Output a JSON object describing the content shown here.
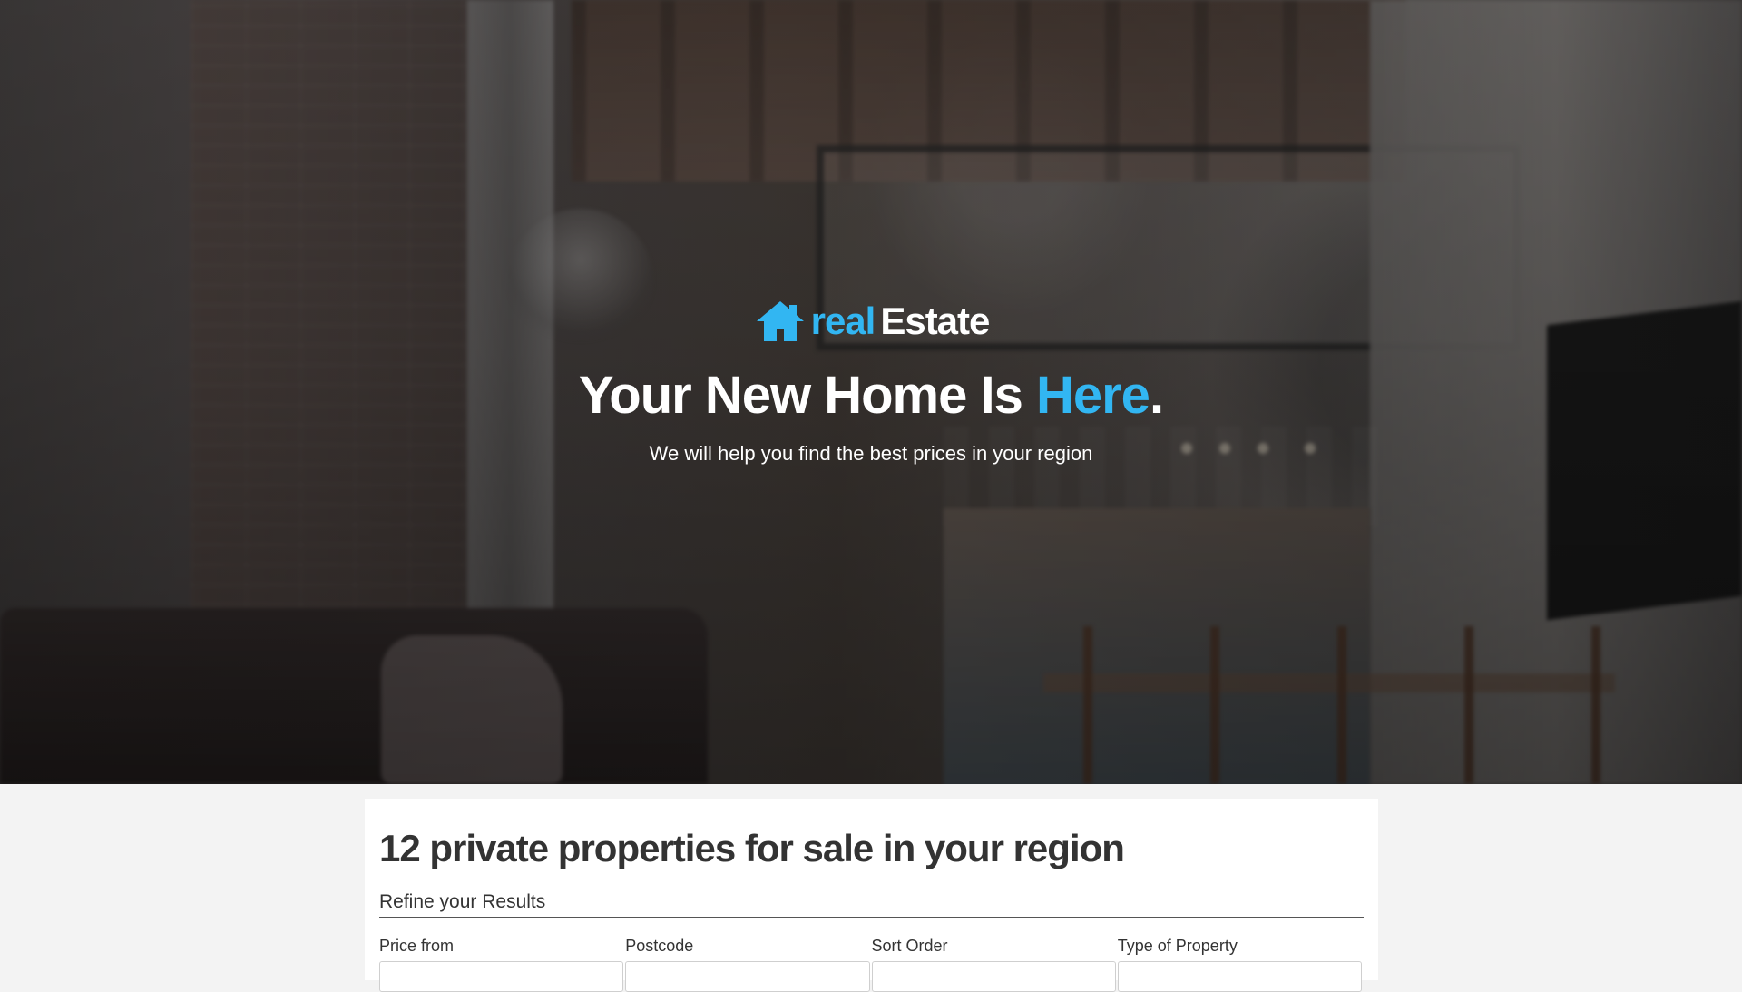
{
  "hero": {
    "brand_real": "real",
    "brand_estate": "Estate",
    "title_prefix": "Your New Home Is ",
    "title_highlight": "Here",
    "title_suffix": ".",
    "subtitle": "We will help you find the best prices in your region",
    "icon": "home-icon"
  },
  "results": {
    "heading": "12 private properties for sale in your region",
    "refine_title": "Refine your Results",
    "filters": [
      {
        "label": "Price from",
        "value": ""
      },
      {
        "label": "Postcode",
        "value": ""
      },
      {
        "label": "Sort Order",
        "value": ""
      },
      {
        "label": "Type of Property",
        "value": ""
      }
    ]
  },
  "colors": {
    "accent": "#32b6f2",
    "text_dark": "#333333",
    "page_background": "#f3f3f3",
    "panel_background": "#ffffff"
  }
}
